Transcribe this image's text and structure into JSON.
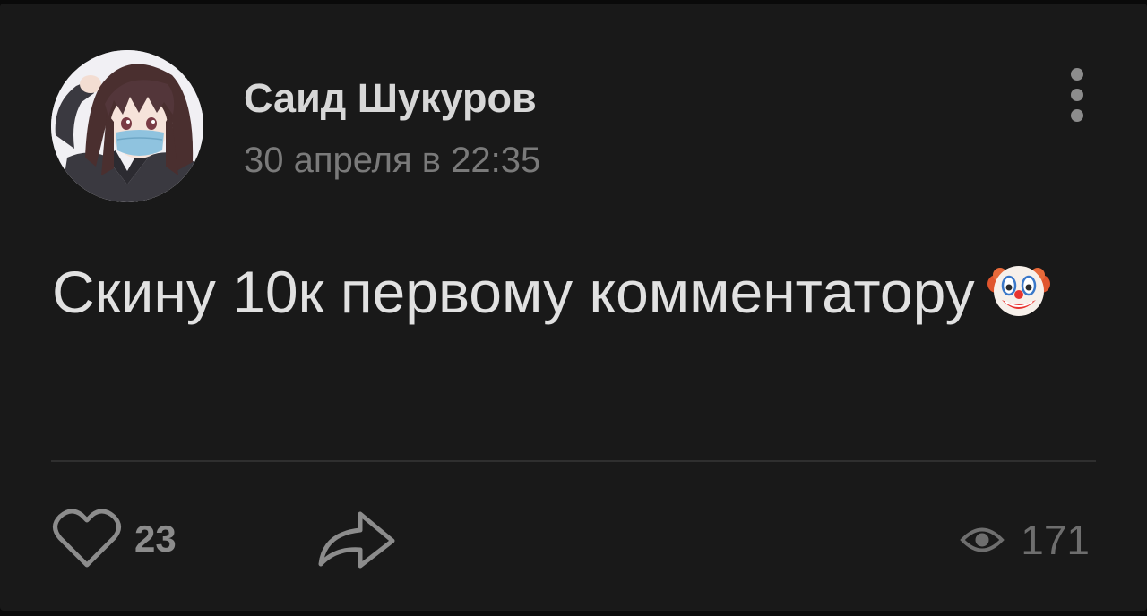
{
  "post": {
    "author": {
      "name": "Саид Шукуров",
      "avatar": "anime-girl-with-face-mask-avatar"
    },
    "date": "30 апреля в 22:35",
    "text": "Скину 10к первому комментатору",
    "emoji": "clown-face-icon",
    "actions": {
      "like_count": "23",
      "like_icon": "heart-outline-icon",
      "share_icon": "share-arrow-icon",
      "more_icon": "vertical-dots-icon"
    },
    "views": {
      "count": "171",
      "icon": "eye-icon"
    }
  },
  "colors": {
    "background": "#191919",
    "name": "#d7d7d7",
    "date": "#7a7a7a",
    "text": "#e1e1e1",
    "icons": "#8c8c8c"
  }
}
